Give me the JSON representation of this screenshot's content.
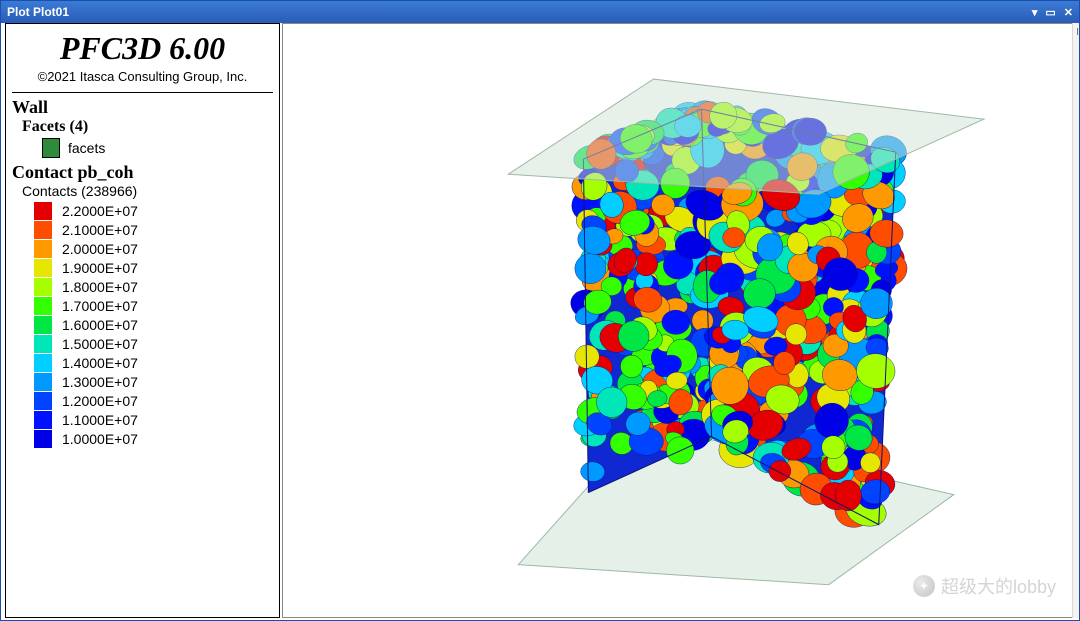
{
  "window": {
    "title": "Plot Plot01"
  },
  "brand": {
    "title": "PFC3D 6.00",
    "subtitle": "©2021 Itasca Consulting Group, Inc."
  },
  "wall": {
    "heading": "Wall",
    "sub": "Facets (4)",
    "item": "facets"
  },
  "contact": {
    "heading": "Contact pb_coh",
    "sub": "Contacts (238966)"
  },
  "legend": [
    {
      "color": "#e40000",
      "value": "2.2000E+07"
    },
    {
      "color": "#ff4d00",
      "value": "2.1000E+07"
    },
    {
      "color": "#ff9900",
      "value": "2.0000E+07"
    },
    {
      "color": "#e6e600",
      "value": "1.9000E+07"
    },
    {
      "color": "#a6ff00",
      "value": "1.8000E+07"
    },
    {
      "color": "#33ff00",
      "value": "1.7000E+07"
    },
    {
      "color": "#00e645",
      "value": "1.6000E+07"
    },
    {
      "color": "#00e6b8",
      "value": "1.5000E+07"
    },
    {
      "color": "#00cfff",
      "value": "1.4000E+07"
    },
    {
      "color": "#0099ff",
      "value": "1.3000E+07"
    },
    {
      "color": "#0044ff",
      "value": "1.2000E+07"
    },
    {
      "color": "#0011ff",
      "value": "1.1000E+07"
    },
    {
      "color": "#0000e6",
      "value": "1.0000E+07"
    }
  ],
  "watermark": {
    "text": "超级大的lobby"
  },
  "colors": {
    "titlebar": "#2a5cb8"
  },
  "chart_data": {
    "type": "heatmap",
    "title": "Contact pb_coh",
    "wall_facets": 4,
    "contacts_count": 238966,
    "colorbar_values": [
      22000000.0,
      21000000.0,
      20000000.0,
      19000000.0,
      18000000.0,
      17000000.0,
      16000000.0,
      15000000.0,
      14000000.0,
      13000000.0,
      12000000.0,
      11000000.0,
      10000000.0
    ],
    "color_range": {
      "min": 10000000.0,
      "max": 22000000.0,
      "units": "pb_coh"
    }
  }
}
